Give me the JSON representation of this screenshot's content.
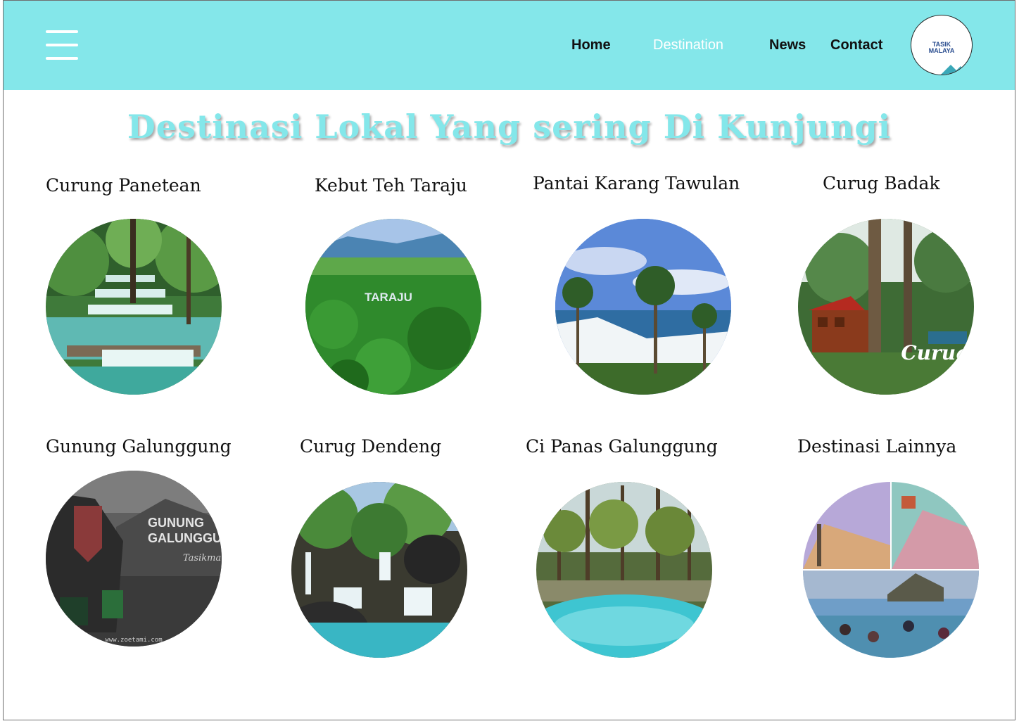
{
  "nav": {
    "home": "Home",
    "destination": "Destination",
    "news": "News",
    "contact": "Contact"
  },
  "logo": {
    "line1": "TASIK",
    "line2": "MALAYA"
  },
  "page": {
    "title": "Destinasi Lokal Yang sering Di Kunjungi"
  },
  "destinations": [
    {
      "name": "Curung Panetean",
      "image": "waterfall-forest"
    },
    {
      "name": "Kebut Teh Taraju",
      "image": "tea-plantation",
      "sign": "TARAJU"
    },
    {
      "name": "Pantai Karang Tawulan",
      "image": "beach-palms"
    },
    {
      "name": "Curug Badak",
      "image": "forest-house",
      "sign": "Curug"
    },
    {
      "name": "Gunung Galunggung",
      "image": "mountain-sign",
      "sign1": "GUNUNG",
      "sign2": "GALUNGGU",
      "sign3": "Tasikma",
      "sign4": "www.zoetami.com"
    },
    {
      "name": "Curug Dendeng",
      "image": "waterfall-rocks"
    },
    {
      "name": "Ci Panas Galunggung",
      "image": "forest-pool"
    },
    {
      "name": "Destinasi Lainnya",
      "image": "collage"
    }
  ],
  "colors": {
    "header": "#84e7ea",
    "title": "#84e7ea",
    "active_nav": "#ffffff"
  }
}
